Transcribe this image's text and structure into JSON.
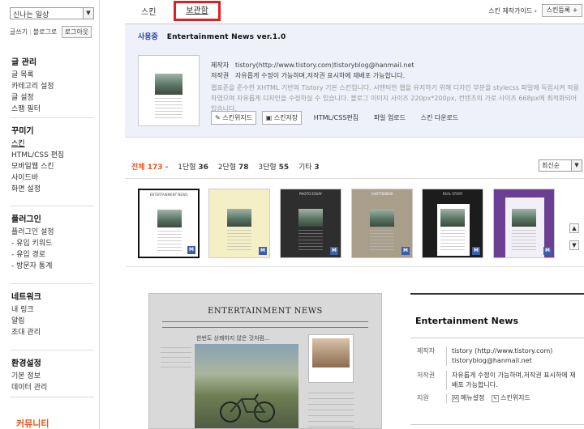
{
  "sidebar": {
    "blog_select": "신나는 일상",
    "links": {
      "write": "글쓰기",
      "blog": "블로그로",
      "logout": "로그아웃"
    },
    "groups": [
      {
        "title": "글 관리",
        "items": [
          "글 목록",
          "카테고리 설정",
          "글 설정",
          "스팸 필터"
        ]
      },
      {
        "title": "꾸미기",
        "items": [
          "스킨",
          "HTML/CSS 편집",
          "모바일웹 스킨",
          "사이드바",
          "화면 설정"
        ]
      },
      {
        "title": "플러그인",
        "items": [
          "플러그인 설정",
          "- 유입 키워드",
          "- 유입 경로",
          "- 방문자 통계"
        ]
      },
      {
        "title": "네트워크",
        "items": [
          "내 링크",
          "알림",
          "초대 관리"
        ]
      },
      {
        "title": "환경설정",
        "items": [
          "기본 정보",
          "데이터 관리"
        ]
      }
    ],
    "promo": "커뮤니티"
  },
  "topbar": {
    "tab_skin": "스킨",
    "tab_storage": "보관함",
    "guide": "스킨 제작가이드 ›",
    "register": "스킨등록 +"
  },
  "current": {
    "inuse": "사용중",
    "name": "Entertainment News ver.1.0",
    "maker_label": "제작자",
    "maker": "tistory(http://www.tistory.com)tistoryblog@hanmail.net",
    "rights_label": "저작권",
    "rights": "자유롭게 수정이 가능하며,저작권 표시하에 재배포 가능합니다.",
    "desc": "웹표준을 준수한 XHTML 기반의 Tistory 기본 스킨입니다. 시맨틱한 웹을 유지하기 위해 디자인 부분을 stylecss 파일에 독립시켜 적용하였으며 자유롭게 디자인을 수정하실 수 있습니다. 블로그 이미지 사이즈 220px*200px, 컨텐츠의 가로 사이즈 668px에 최적화되어 있습니다.",
    "btn_widget": "스킨위지드",
    "btn_save": "스킨저장",
    "link_html": "HTML/CSS편집",
    "link_upload": "파일 업로드",
    "link_download": "스킨 다운로드"
  },
  "filters": [
    {
      "label": "전체",
      "count": "173",
      "active": true
    },
    {
      "label": "1단형",
      "count": "36"
    },
    {
      "label": "2단형",
      "count": "78"
    },
    {
      "label": "3단형",
      "count": "55"
    },
    {
      "label": "기타",
      "count": "3"
    }
  ],
  "sort": "최신순",
  "thumbnails": [
    {
      "title": "ENTERTAINMENT NEWS",
      "bg": "#ffffff"
    },
    {
      "title": "",
      "bg": "#f4efc5"
    },
    {
      "title": "PHOTO ESSAY",
      "bg": "#2e2e2e"
    },
    {
      "title": "CHATTERBOX",
      "bg": "#a99e8a"
    },
    {
      "title": "REAL STORY",
      "bg": "#1c1c1c"
    },
    {
      "title": "",
      "bg": "#6b3f93"
    }
  ],
  "preview": {
    "title": "ENTERTAINMENT NEWS",
    "caption": "한번도 상쾌하지 않은 것처럼..."
  },
  "detail": {
    "title": "Entertainment News",
    "maker_label": "제작자",
    "maker": "tistory (http://www.tistory.com) tistoryblog@hanmail.net",
    "rights_label": "저작권",
    "rights": "자유롭게 수정이 가능하며,저작권 표시하에 재배포 가능합니다.",
    "support_label": "지원",
    "support_menu": "메뉴설정",
    "support_widget": "스킨위지드"
  }
}
